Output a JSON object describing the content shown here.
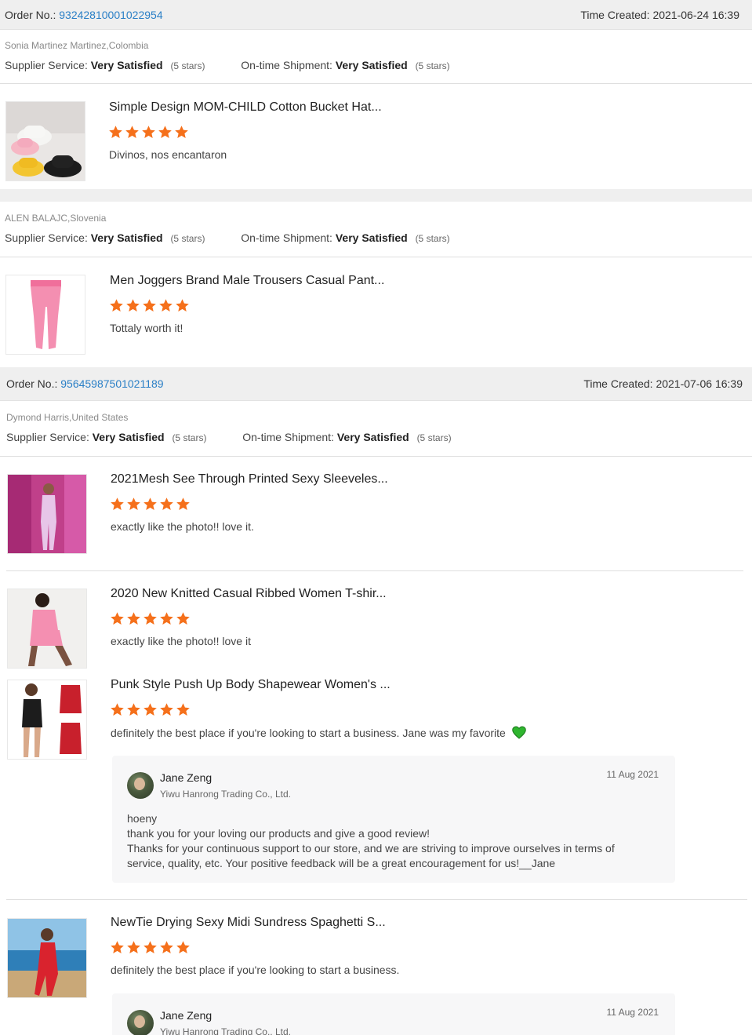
{
  "orders": [
    {
      "label": "Order No.:",
      "number": "93242810001022954",
      "time_label": "Time Created:",
      "time": "2021-06-24 16:39"
    },
    {
      "label": "Order No.:",
      "number": "95645987501021189",
      "time_label": "Time Created:",
      "time": "2021-07-06 16:39"
    }
  ],
  "ratings_labels": {
    "supplier": "Supplier Service:",
    "shipment": "On-time Shipment:",
    "value": "Very Satisfied",
    "stars": "(5 stars)"
  },
  "buyers": [
    {
      "name": "Sonia Martinez Martinez,Colombia"
    },
    {
      "name": "ALEN BALAJC,Slovenia"
    },
    {
      "name": "Dymond Harris,United States"
    }
  ],
  "products": [
    {
      "title": "Simple Design MOM-CHILD Cotton Bucket Hat...",
      "rating": 5,
      "review": "Divinos, nos encantaron"
    },
    {
      "title": "Men Joggers Brand Male Trousers Casual Pant...",
      "rating": 5,
      "review": "Tottaly worth it!"
    },
    {
      "title": "2021Mesh See Through Printed Sexy Sleeveles...",
      "rating": 5,
      "review": "exactly like the photo!! love it."
    },
    {
      "title": "2020 New Knitted Casual Ribbed Women T-shir...",
      "rating": 5,
      "review": "exactly like the photo!! love it"
    },
    {
      "title": "Punk Style Push Up Body Shapewear Women's ...",
      "rating": 5,
      "review": "definitely the best place if you're looking to start a business. Jane was my favorite"
    },
    {
      "title": "NewTie Drying Sexy Midi Sundress Spaghetti S...",
      "rating": 5,
      "review": "definitely the best place if you're looking to start a business."
    }
  ],
  "replies": [
    {
      "name": "Jane Zeng",
      "company": "Yiwu Hanrong Trading Co., Ltd.",
      "date": "11 Aug 2021",
      "lines": [
        "hoeny",
        "thank you for your loving our products and give a good review!",
        "Thanks for your continuous support to our store, and we are striving to improve ourselves in terms of",
        "service, quality, etc. Your positive feedback will be a great encouragement for us!__Jane"
      ]
    },
    {
      "name": "Jane Zeng",
      "company": "Yiwu Hanrong Trading Co., Ltd.",
      "date": "11 Aug 2021"
    }
  ],
  "colors": {
    "link": "#2a7fc6",
    "star": "#f5701b",
    "heart": "#2fb52f",
    "bar": "#efefef"
  },
  "icons": {
    "star": "star-icon",
    "heart": "green-heart-icon",
    "avatar": "avatar"
  }
}
